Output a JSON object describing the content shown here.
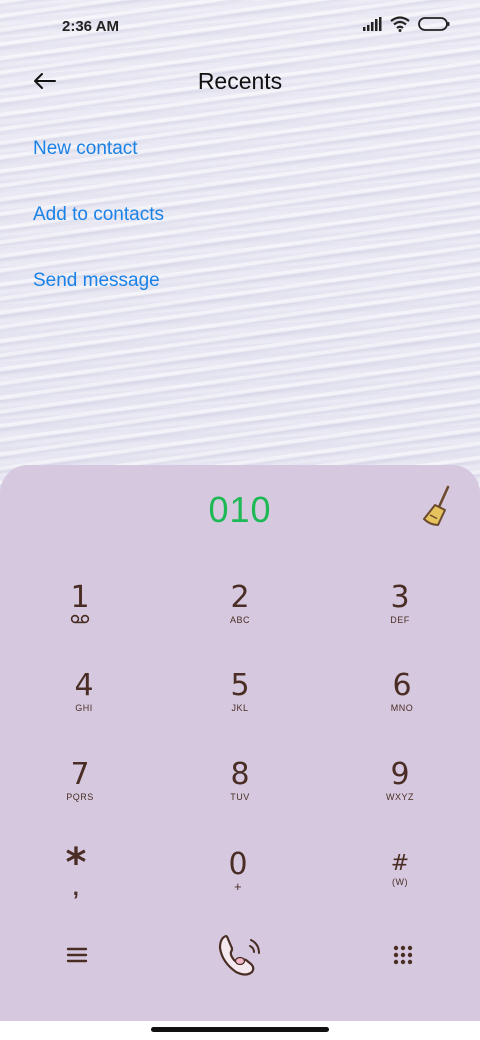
{
  "status_bar": {
    "time": "2:36 AM"
  },
  "header": {
    "title": "Recents"
  },
  "menu": [
    {
      "label": "New contact"
    },
    {
      "label": "Add to contacts"
    },
    {
      "label": "Send message"
    }
  ],
  "dialpad": {
    "number": "010",
    "keys": [
      {
        "digit": "1",
        "letters": ""
      },
      {
        "digit": "2",
        "letters": "ABC"
      },
      {
        "digit": "3",
        "letters": "DEF"
      },
      {
        "digit": "4",
        "letters": "GHI"
      },
      {
        "digit": "5",
        "letters": "JKL"
      },
      {
        "digit": "6",
        "letters": "MNO"
      },
      {
        "digit": "7",
        "letters": "PQRS"
      },
      {
        "digit": "8",
        "letters": "TUV"
      },
      {
        "digit": "9",
        "letters": "WXYZ"
      },
      {
        "digit": "*",
        "letters": ","
      },
      {
        "digit": "0",
        "letters": "+"
      },
      {
        "digit": "#",
        "letters": "(W)"
      }
    ]
  },
  "colors": {
    "accent_link": "#1a82e6",
    "number_green": "#1db954",
    "dialpad_bg": "#d6c9df",
    "key_text": "#4a2d24"
  },
  "icons": [
    "back-arrow-icon",
    "signal-icon",
    "wifi-icon",
    "battery-icon",
    "broom-icon",
    "voicemail-icon",
    "menu-icon",
    "call-icon",
    "keypad-grid-icon"
  ]
}
